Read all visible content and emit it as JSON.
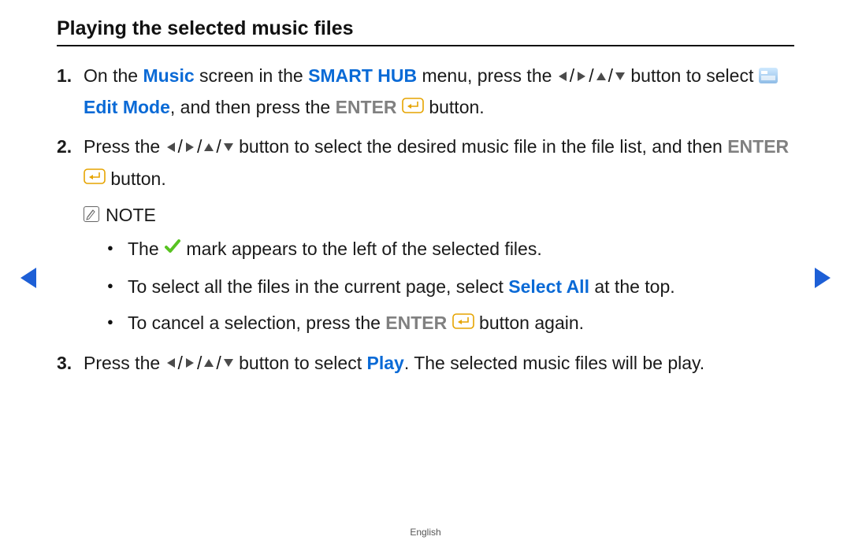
{
  "title": "Playing the selected music files",
  "steps": {
    "s1": {
      "p1": "On the ",
      "music": "Music",
      "p2": " screen in the ",
      "smart_hub": "SMART HUB",
      "p3": " menu, press the ",
      "p4": " button to select ",
      "edit_mode": "Edit Mode",
      "p5": ", and then press the ",
      "enter": "ENTER",
      "p6": " button."
    },
    "s2": {
      "p1": "Press the ",
      "p2": " button to select the desired music file in the file list, and then ",
      "enter": "ENTER",
      "p3": " button."
    },
    "s3": {
      "p1": "Press the ",
      "p2": " button to select ",
      "play": "Play",
      "p3": ". The selected music files will be play."
    }
  },
  "note": {
    "label": "NOTE",
    "b1": {
      "p1": "The ",
      "p2": " mark appears to the left of the selected files."
    },
    "b2": {
      "p1": "To select all the files in the current page, select ",
      "select_all": "Select All",
      "p2": " at the top."
    },
    "b3": {
      "p1": "To cancel a selection, press the ",
      "enter": "ENTER",
      "p2": " button again."
    }
  },
  "footer": "English",
  "glyphs": {
    "slash": "/"
  }
}
